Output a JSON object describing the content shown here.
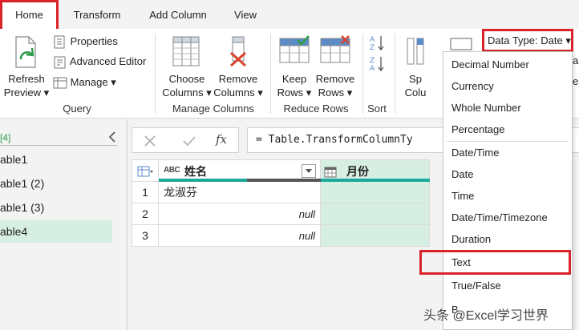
{
  "tabs": [
    {
      "label": "Home"
    },
    {
      "label": "Transform"
    },
    {
      "label": "Add Column"
    },
    {
      "label": "View"
    }
  ],
  "query_group": {
    "refresh_label_1": "Refresh",
    "refresh_label_2": "Preview",
    "properties_label": "Properties",
    "advanced_editor_label": "Advanced Editor",
    "manage_label": "Manage",
    "group_label": "Query"
  },
  "manage_columns_group": {
    "choose_label_1": "Choose",
    "choose_label_2": "Columns",
    "remove_label_1": "Remove",
    "remove_label_2": "Columns",
    "group_label": "Manage Columns"
  },
  "reduce_rows_group": {
    "keep_label_1": "Keep",
    "keep_label_2": "Rows",
    "remove_label_1": "Remove",
    "remove_label_2": "Rows",
    "group_label": "Reduce Rows"
  },
  "sort_group": {
    "group_label": "Sort"
  },
  "split_partial": {
    "label_1": "Sp",
    "label_2": "Colu"
  },
  "data_type_button": {
    "label": "Data Type: Date"
  },
  "data_type_menu": {
    "items": [
      "Decimal Number",
      "Currency",
      "Whole Number",
      "Percentage",
      "Date/Time",
      "Date",
      "Time",
      "Date/Time/Timezone",
      "Duration",
      "Text",
      "True/False",
      "B"
    ]
  },
  "queries_pane": {
    "count_label": "[4]",
    "items": [
      "able1",
      "able1 (2)",
      "able1 (3)",
      "able4"
    ]
  },
  "formula_bar": {
    "fx_label": "fx",
    "formula": "= Table.TransformColumnTy",
    "tail": ","
  },
  "table": {
    "col1_type": "ABC",
    "col1_header": "姓名",
    "col2_header": "月份",
    "rows": [
      {
        "index": "1",
        "name": "龙淑芬"
      },
      {
        "index": "2",
        "name": "null"
      },
      {
        "index": "3",
        "name": "null"
      }
    ]
  },
  "right_partial": {
    "top": "as",
    "bottom": "es"
  },
  "watermark": "头条 @Excel学习世界",
  "colors": {
    "highlight": "#d9232a",
    "selected_query": "#d7efe3",
    "date_column": "#d7efe3",
    "teal_bar": "#1aa99a"
  }
}
